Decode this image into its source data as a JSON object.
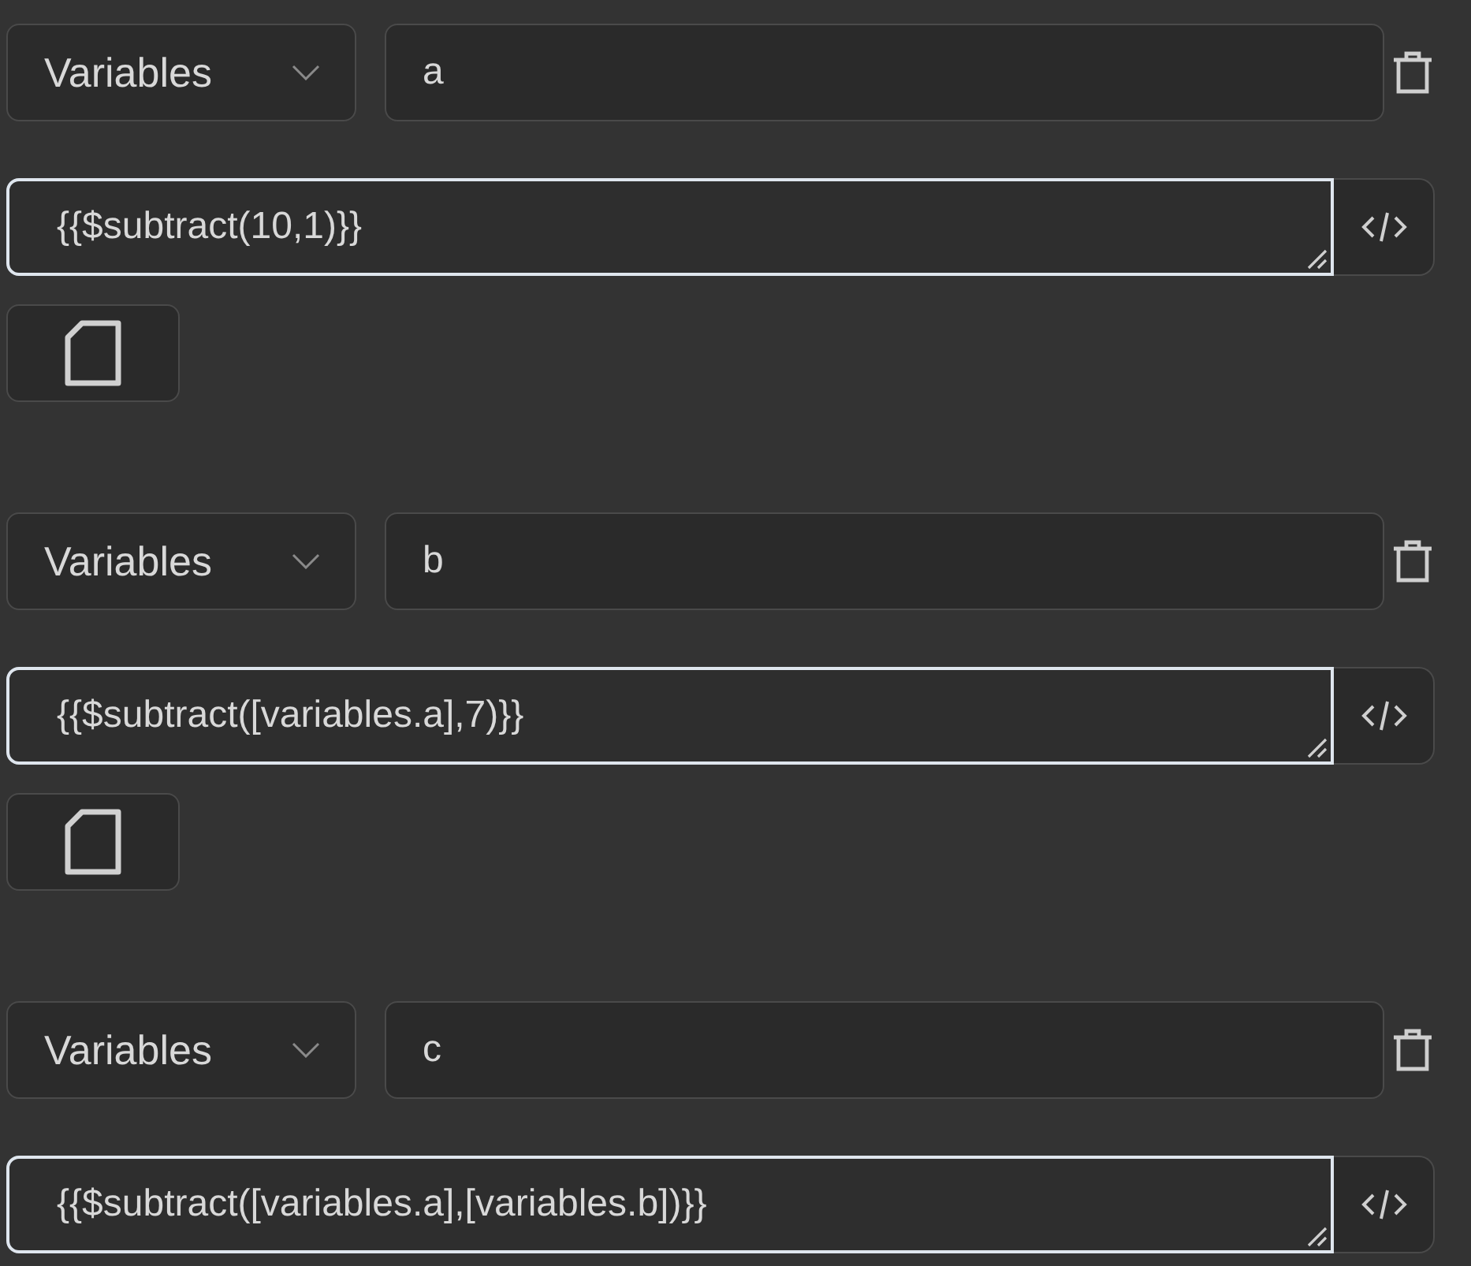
{
  "blocks": [
    {
      "source": "Variables",
      "name": "a",
      "expression": "{{$subtract(10,1)}}",
      "copy_button": true
    },
    {
      "source": "Variables",
      "name": "b",
      "expression": "{{$subtract([variables.a],7)}}",
      "copy_button": true
    },
    {
      "source": "Variables",
      "name": "c",
      "expression": "{{$subtract([variables.a],[variables.b])}}",
      "copy_button": false
    }
  ]
}
